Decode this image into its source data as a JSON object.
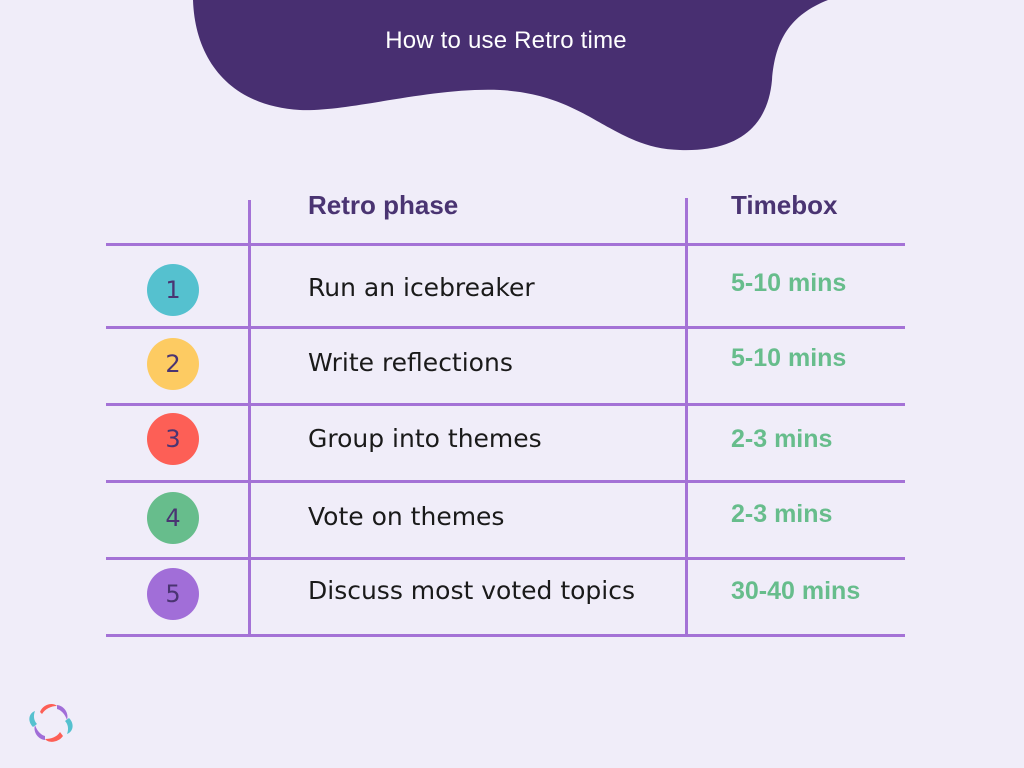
{
  "header": {
    "title": "How to use Retro time"
  },
  "table": {
    "columns": [
      "",
      "Retro phase",
      "Timebox"
    ],
    "rows": [
      {
        "step": "1",
        "phase": "Run an icebreaker",
        "timebox": "5-10 mins",
        "badge_color": "#55c1cf"
      },
      {
        "step": "2",
        "phase": "Write reflections",
        "timebox": "5-10 mins",
        "badge_color": "#fdcb62"
      },
      {
        "step": "3",
        "phase": "Group into themes",
        "timebox": "2-3 mins",
        "badge_color": "#fd5f56"
      },
      {
        "step": "4",
        "phase": "Vote on themes",
        "timebox": "2-3 mins",
        "badge_color": "#67bd8c"
      },
      {
        "step": "5",
        "phase": "Discuss most voted topics",
        "timebox": "30-40 mins",
        "badge_color": "#a16ed8"
      }
    ]
  },
  "colors": {
    "background": "#f0edf9",
    "blob": "#482f71",
    "grid": "#a472d6",
    "header_text": "#4a3472",
    "timebox_text": "#67bd8c"
  },
  "logo": {
    "icon": "retro-logo-icon"
  }
}
